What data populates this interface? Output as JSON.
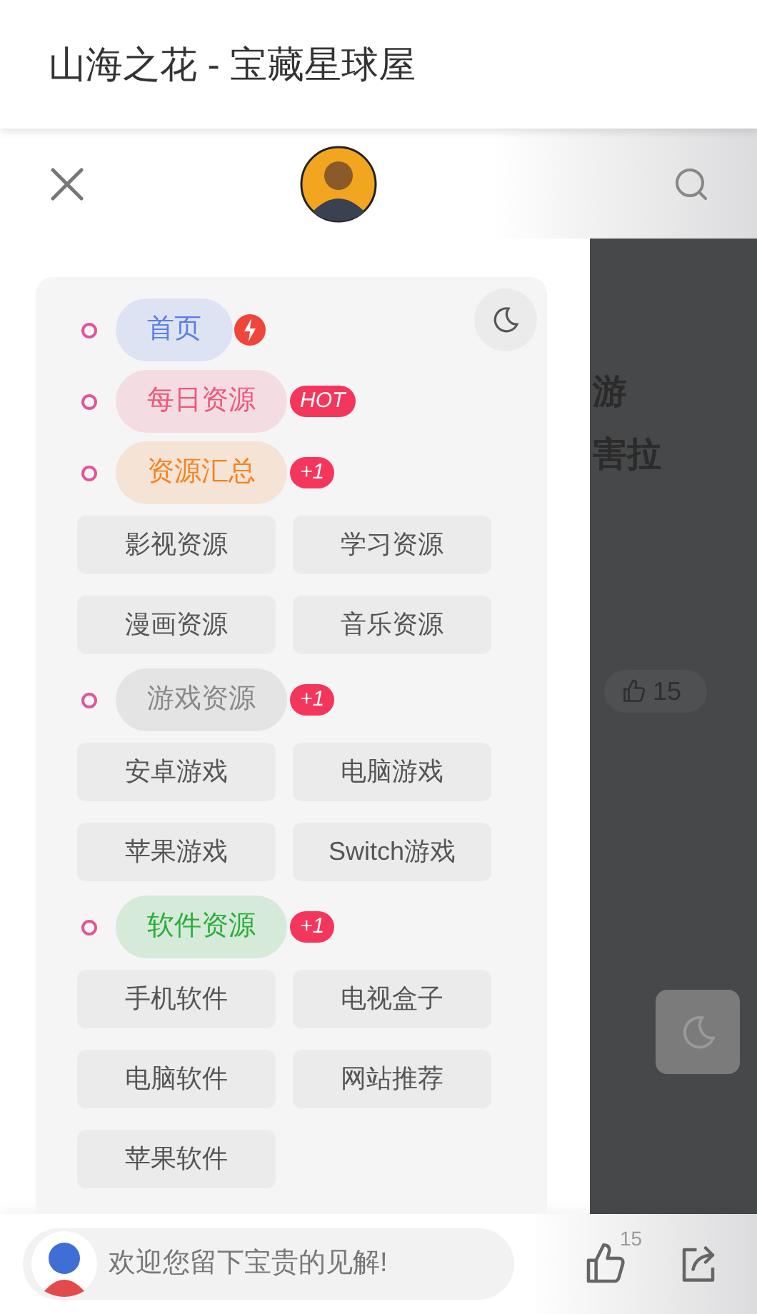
{
  "app_bar": {
    "title": "山海之花 - 宝藏星球屋"
  },
  "drawer": {
    "menu": [
      {
        "label": "首页",
        "color": "#5b7fe8",
        "badge": {
          "kind": "icon"
        }
      },
      {
        "label": "每日资源",
        "color": "#f0567a",
        "badge": {
          "kind": "text",
          "text": "HOT"
        }
      },
      {
        "label": "资源汇总",
        "color": "#f5821f",
        "badge": {
          "kind": "text",
          "text": "+1"
        },
        "children": [
          "影视资源",
          "学习资源",
          "漫画资源",
          "音乐资源"
        ]
      },
      {
        "label": "游戏资源",
        "color": "#888888",
        "badge": {
          "kind": "text",
          "text": "+1"
        },
        "children": [
          "安卓游戏",
          "电脑游戏",
          "苹果游戏",
          "Switch游戏"
        ]
      },
      {
        "label": "软件资源",
        "color": "#2aae3a",
        "badge": {
          "kind": "text",
          "text": "+1"
        },
        "children": [
          "手机软件",
          "电视盒子",
          "电脑软件",
          "网站推荐",
          "苹果软件"
        ]
      }
    ]
  },
  "background_page": {
    "title_lines": [
      "游",
      "害拉"
    ],
    "like_count": "15"
  },
  "bottom_bar": {
    "comment": {
      "placeholder": "欢迎您留下宝贵的见解!"
    },
    "like_count": "15"
  }
}
